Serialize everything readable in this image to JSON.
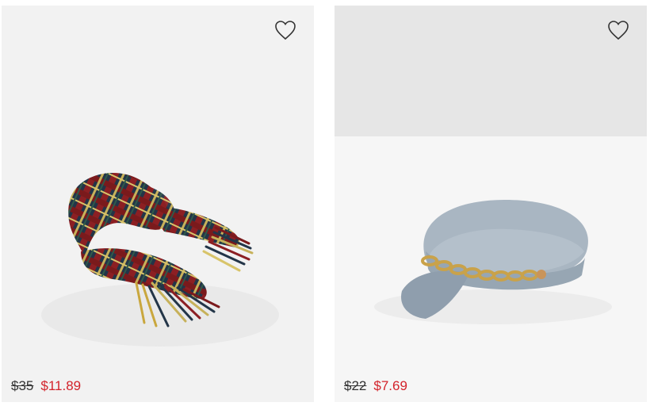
{
  "products": [
    {
      "image_icon": "plaid-scarf",
      "wishlist_icon": "heart-outline-icon",
      "price_original": "$35",
      "price_sale": "$11.89"
    },
    {
      "image_icon": "denim-fisherman-cap",
      "wishlist_icon": "heart-outline-icon",
      "price_original": "$22",
      "price_sale": "$7.69"
    }
  ],
  "colors": {
    "sale_price": "#d3232b",
    "original_price": "#333333",
    "card_bg": "#f2f2f2"
  }
}
